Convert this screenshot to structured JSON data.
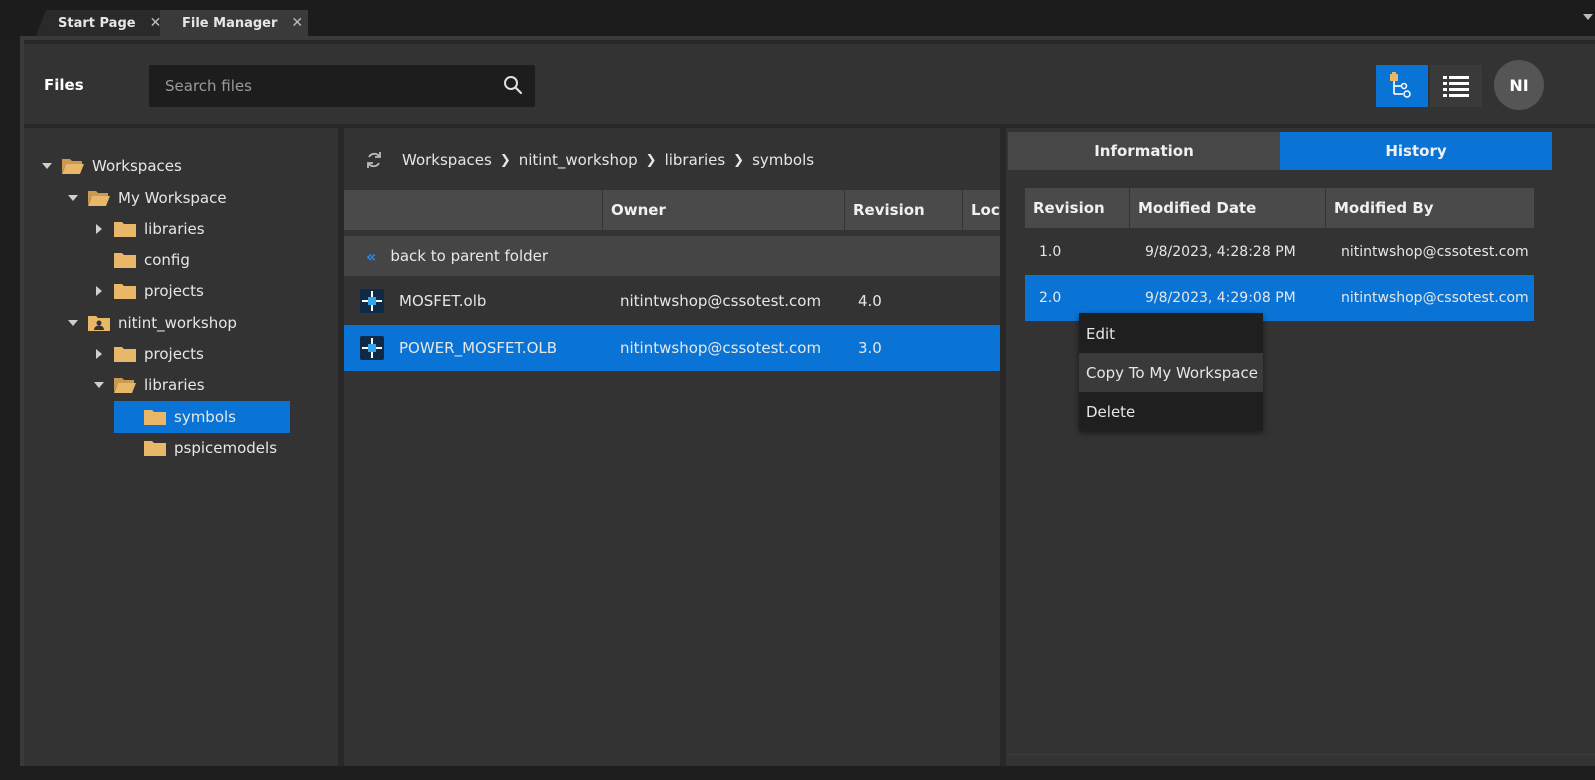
{
  "tabs": [
    {
      "label": "Start Page",
      "close": "✕"
    },
    {
      "label": "File Manager",
      "close": "✕"
    }
  ],
  "header": {
    "files_label": "Files",
    "search_placeholder": "Search files",
    "avatar_initials": "NI"
  },
  "tree": [
    {
      "label": "Workspaces",
      "caret": "down",
      "folder": "open"
    },
    {
      "label": "My Workspace",
      "caret": "down",
      "folder": "open"
    },
    {
      "label": "libraries",
      "caret": "right",
      "folder": "closed"
    },
    {
      "label": "config",
      "caret": "none",
      "folder": "closed"
    },
    {
      "label": "projects",
      "caret": "right",
      "folder": "closed"
    },
    {
      "label": "nitint_workshop",
      "caret": "down",
      "folder": "user"
    },
    {
      "label": "projects",
      "caret": "right",
      "folder": "closed"
    },
    {
      "label": "libraries",
      "caret": "down",
      "folder": "open"
    },
    {
      "label": "symbols",
      "caret": "none",
      "folder": "closed",
      "selected": true
    },
    {
      "label": "pspicemodels",
      "caret": "none",
      "folder": "closed"
    }
  ],
  "breadcrumb": {
    "parts": [
      "Workspaces",
      "nitint_workshop",
      "libraries",
      "symbols"
    ],
    "sep": "❯"
  },
  "grid": {
    "columns": [
      "Owner",
      "Revision",
      "Locl"
    ],
    "back_label": "back to parent folder",
    "back_icon": "«",
    "rows": [
      {
        "name": "MOSFET.olb",
        "owner": "nitintwshop@cssotest.com",
        "revision": "4.0"
      },
      {
        "name": "POWER_MOSFET.OLB",
        "owner": "nitintwshop@cssotest.com",
        "revision": "3.0",
        "selected": true
      }
    ]
  },
  "details": {
    "tabs": [
      "Information",
      "History"
    ],
    "active_tab": "History",
    "columns": [
      "Revision",
      "Modified Date",
      "Modified By"
    ],
    "rows": [
      {
        "revision": "1.0",
        "date": "9/8/2023, 4:28:28 PM",
        "by": "nitintwshop@cssotest.com"
      },
      {
        "revision": "2.0",
        "date": "9/8/2023, 4:29:08 PM",
        "by": "nitintwshop@cssotest.com",
        "selected": true
      }
    ]
  },
  "context_menu": {
    "items": [
      "Edit",
      "Copy To My Workspace",
      "Delete"
    ],
    "hovered": "Copy To My Workspace"
  },
  "colors": {
    "accent": "#0a74d6",
    "folder": "#e8b768",
    "panel": "#333333"
  }
}
